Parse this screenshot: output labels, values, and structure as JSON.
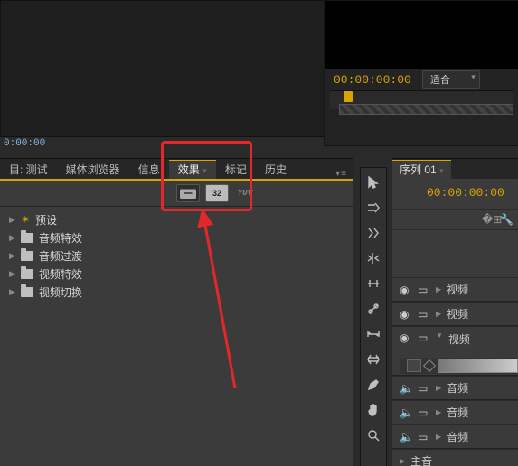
{
  "monitor": {
    "timecode": "00:00:00:00",
    "fit_label": "适合"
  },
  "source_bin": {
    "timecode": "0:00:00"
  },
  "effects_panel": {
    "tabs": {
      "project": "目: 测试",
      "media_browser": "媒体浏览器",
      "info": "信息",
      "effects": "效果",
      "markers": "标记",
      "history": "历史"
    },
    "filter_badge": "32",
    "filter_yuv": "YUV",
    "tree": {
      "presets": "预设",
      "audio_fx": "音频特效",
      "audio_trans": "音频过渡",
      "video_fx": "视频特效",
      "video_trans": "视频切换"
    }
  },
  "sequence_panel": {
    "tab_label": "序列 01",
    "timecode": "00:00:00:00",
    "tracks": {
      "video_prefix": "视频",
      "audio_prefix": "音频",
      "master_audio": "主音"
    }
  }
}
